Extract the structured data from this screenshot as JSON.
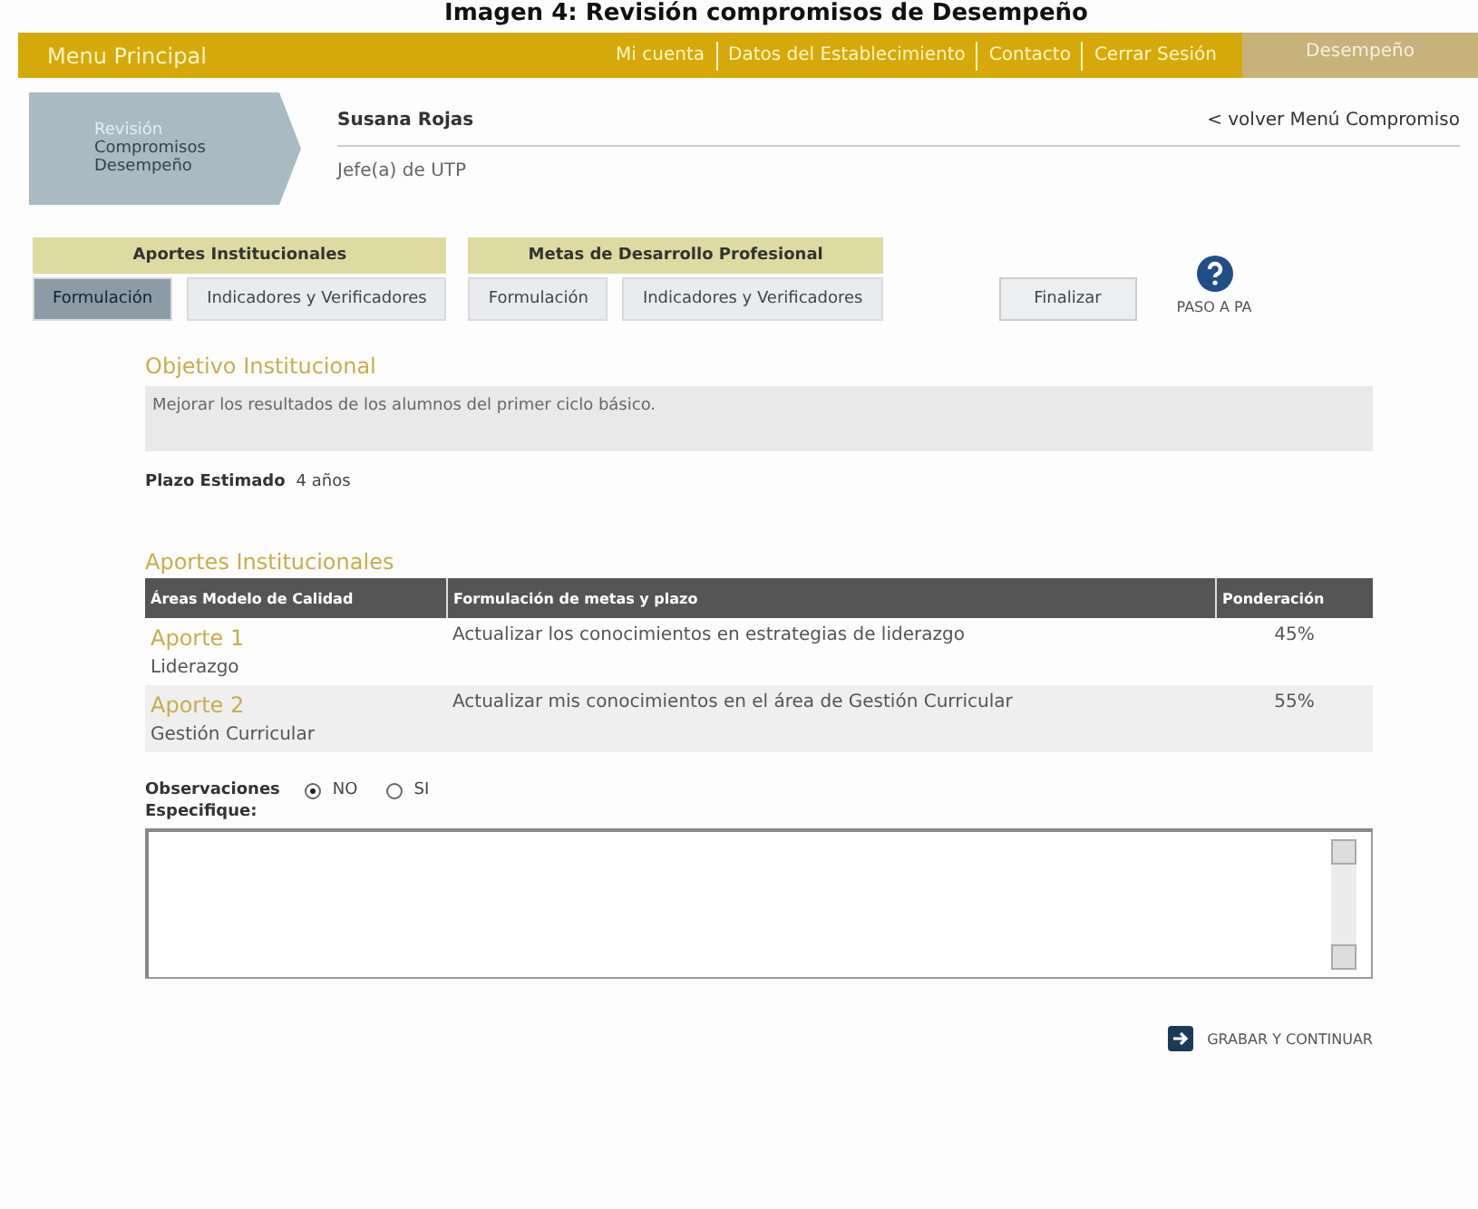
{
  "caption": "Imagen 4: Revisión compromisos de Desempeño",
  "top_bar": {
    "title": "Menu Principal",
    "links": [
      "Mi cuenta",
      "Datos del Establecimiento",
      "Contacto",
      "Cerrar Sesión"
    ],
    "section": "Desempeño"
  },
  "badge": {
    "lines": [
      "Revisión",
      "Compromisos",
      "Desempeño"
    ]
  },
  "user": {
    "name": "Susana Rojas",
    "role": "Jefe(a) de UTP",
    "back_link": "< volver Menú Compromiso"
  },
  "tab_groups": [
    {
      "title": "Aportes Institucionales",
      "tabs": [
        {
          "label": "Formulación",
          "selected": true
        },
        {
          "label": "Indicadores y Verificadores",
          "selected": false
        }
      ]
    },
    {
      "title": "Metas de Desarrollo Profesional",
      "tabs": [
        {
          "label": "Formulación",
          "selected": false
        },
        {
          "label": "Indicadores y Verificadores",
          "selected": false
        }
      ]
    }
  ],
  "finish_button": "Finalizar",
  "help": {
    "label": "PASO A PA"
  },
  "objective": {
    "title": "Objetivo Institucional",
    "text": "Mejorar los resultados de los alumnos del primer ciclo básico.",
    "term_label": "Plazo Estimado",
    "term_value": "4 años"
  },
  "contributions": {
    "title": "Aportes Institucionales",
    "columns": [
      "Áreas Modelo de Calidad",
      "Formulación de metas y plazo",
      "Ponderación"
    ],
    "rows": [
      {
        "name": "Aporte 1",
        "area": "Liderazgo",
        "goal": "Actualizar los conocimientos en estrategias de liderazgo",
        "weight": "45%"
      },
      {
        "name": "Aporte 2",
        "area": "Gestión Curricular",
        "goal": "Actualizar mis conocimientos en el área de Gestión Curricular",
        "weight": "55%"
      }
    ]
  },
  "observations": {
    "label": "Observaciones",
    "options": [
      {
        "label": "NO",
        "selected": true
      },
      {
        "label": "SI",
        "selected": false
      }
    ],
    "specify_label": "Especifique:"
  },
  "save_button": "GRABAR Y CONTINUAR"
}
